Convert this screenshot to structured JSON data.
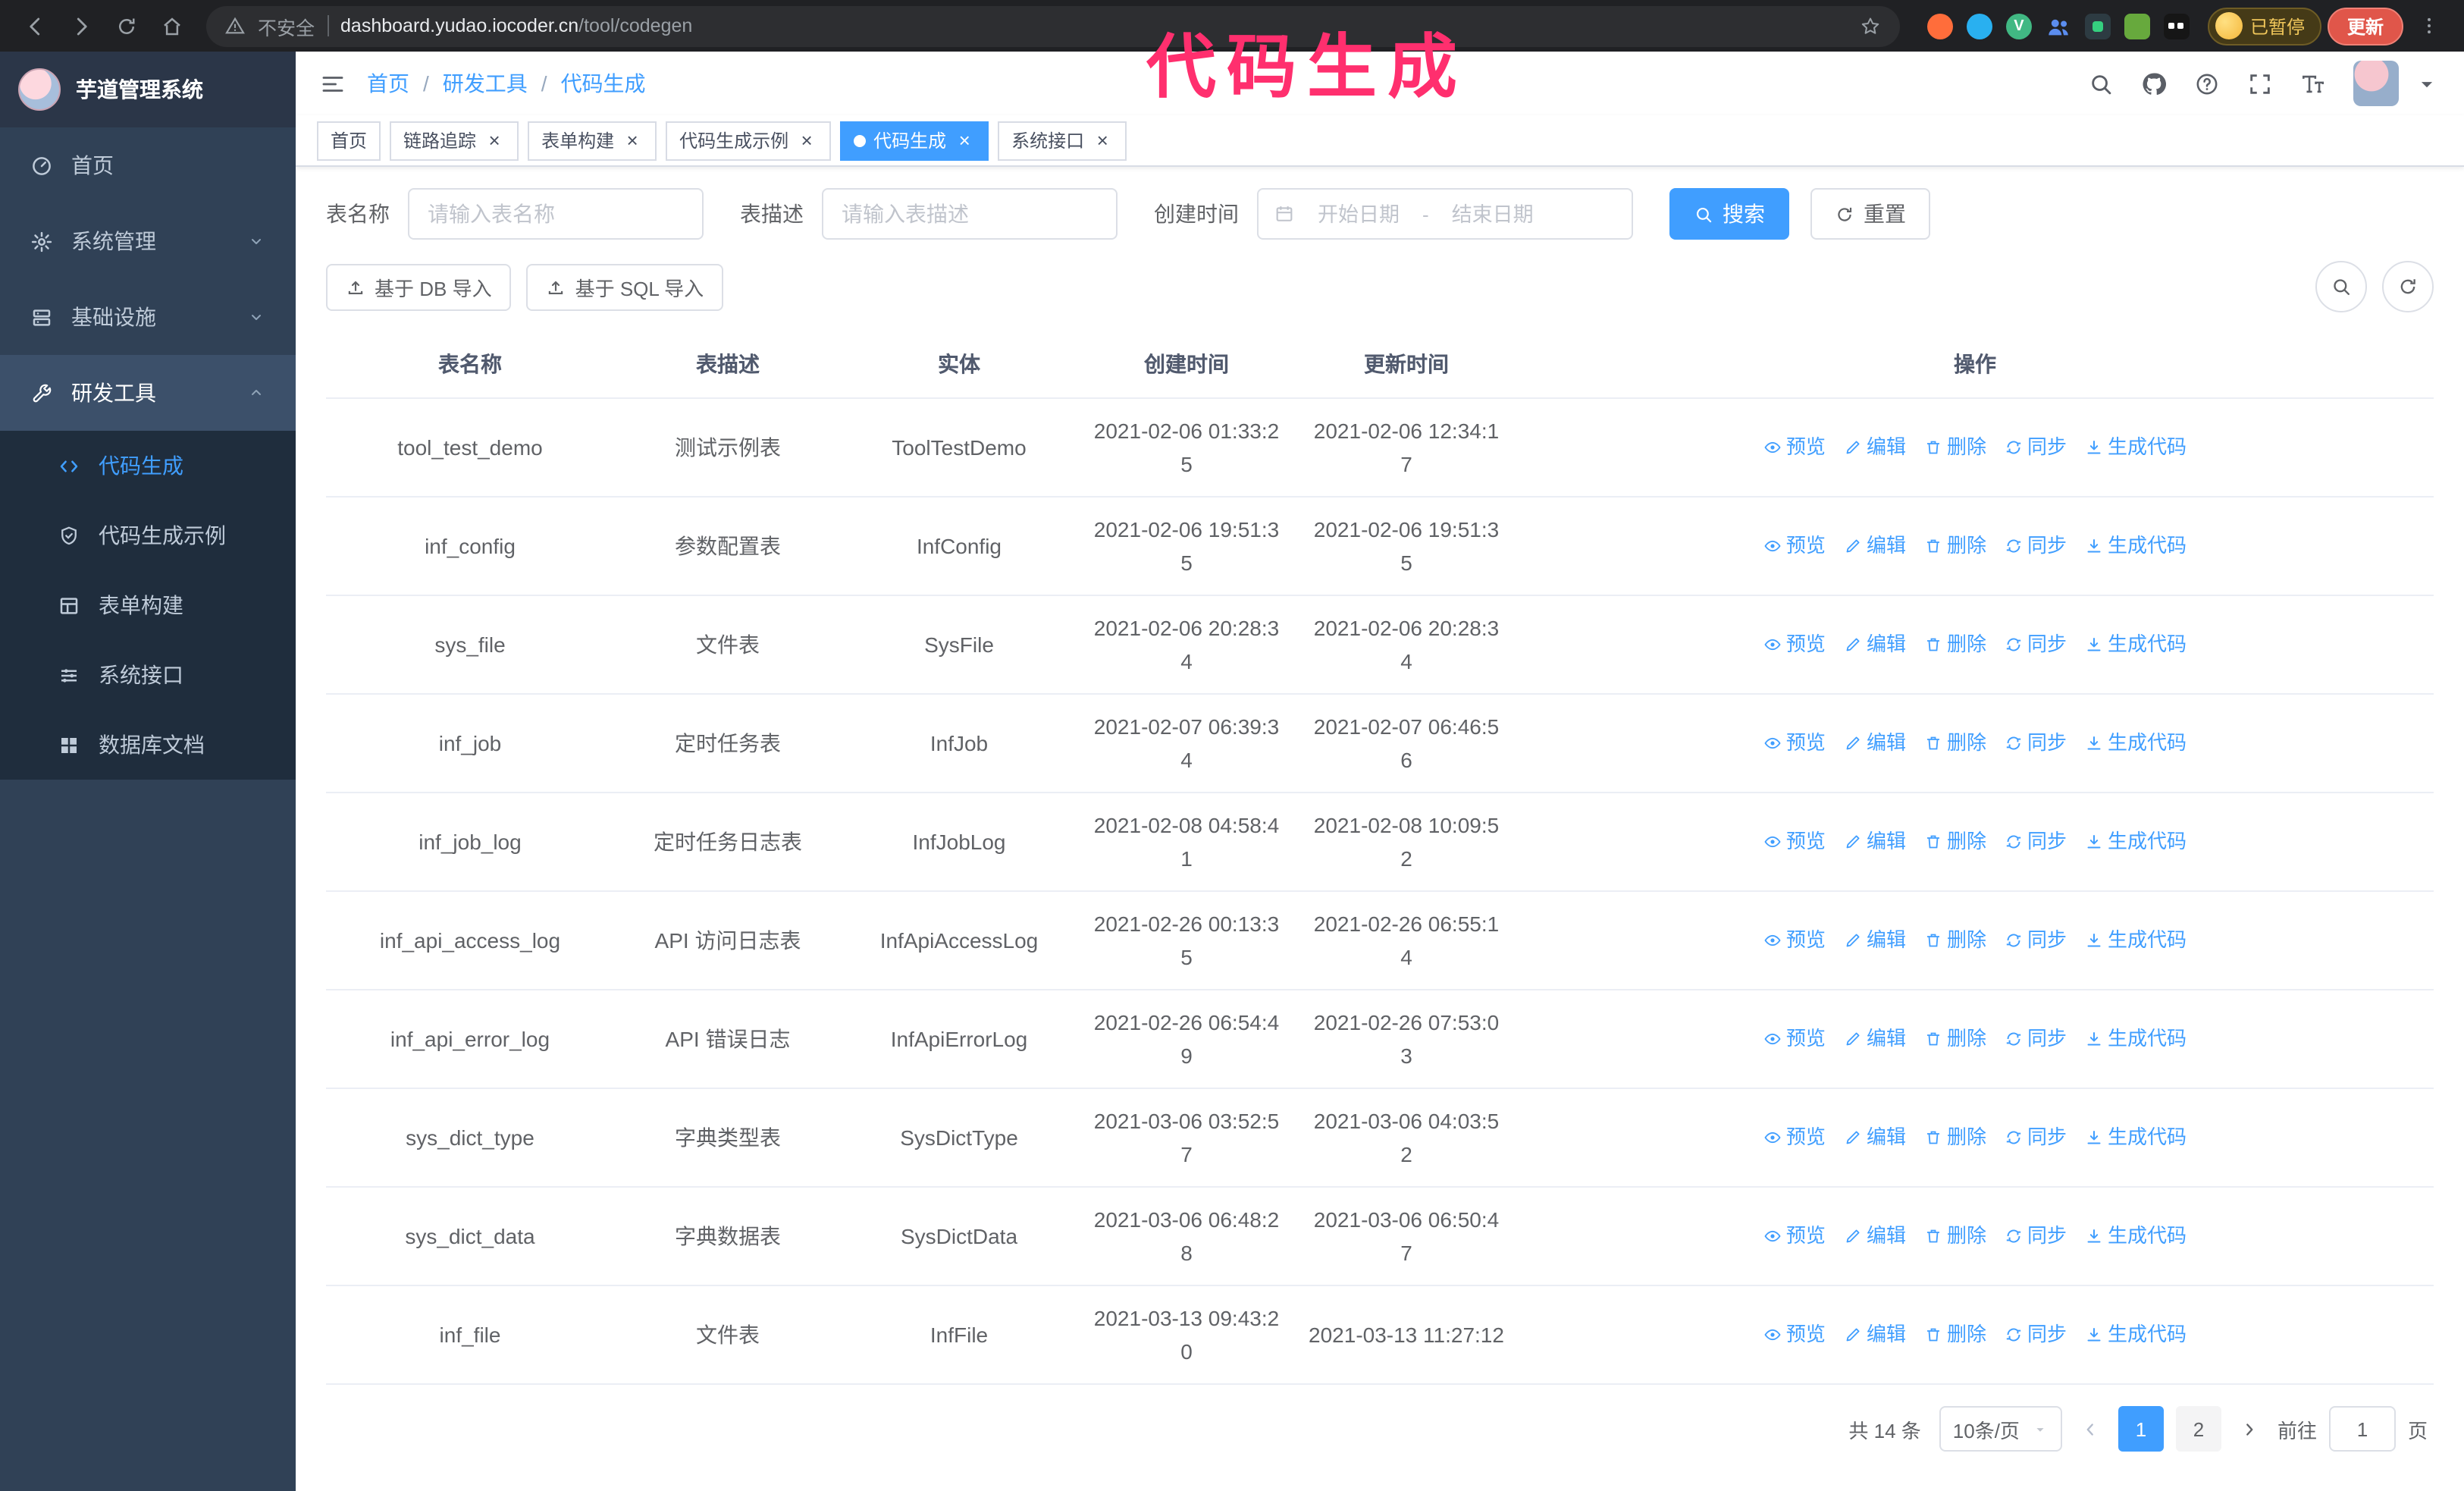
{
  "colors": {
    "accent": "#409eff",
    "sidebar_bg": "#304156",
    "submenu_bg": "#1f2d3d",
    "annotation": "#ff2f6e"
  },
  "annotation": {
    "text": "代码生成"
  },
  "browser": {
    "security_label": "不安全",
    "url_host": "dashboard.yudao.iocoder.cn",
    "url_path": "/tool/codegen",
    "paused_badge": "已暂停",
    "update_button": "更新"
  },
  "sidebar": {
    "logo_title": "芋道管理系统",
    "items": [
      {
        "id": "home",
        "icon": "gauge",
        "label": "首页"
      },
      {
        "id": "system",
        "icon": "gear",
        "label": "系统管理",
        "expandable": true
      },
      {
        "id": "infra",
        "icon": "server",
        "label": "基础设施",
        "expandable": true
      },
      {
        "id": "devtools",
        "icon": "wrench",
        "label": "研发工具",
        "expanded": true
      }
    ],
    "subitems": [
      {
        "id": "codegen",
        "icon": "code",
        "label": "代码生成",
        "active": true
      },
      {
        "id": "codegen-demo",
        "icon": "shield",
        "label": "代码生成示例"
      },
      {
        "id": "form-builder",
        "icon": "form",
        "label": "表单构建"
      },
      {
        "id": "system-api",
        "icon": "sliders",
        "label": "系统接口"
      },
      {
        "id": "db-doc",
        "icon": "grid",
        "label": "数据库文档"
      }
    ]
  },
  "header": {
    "breadcrumb": [
      "首页",
      "研发工具",
      "代码生成"
    ]
  },
  "tags": [
    {
      "id": "home",
      "label": "首页",
      "closable": false
    },
    {
      "id": "tracer",
      "label": "链路追踪",
      "closable": true
    },
    {
      "id": "form-builder",
      "label": "表单构建",
      "closable": true
    },
    {
      "id": "codegen-demo",
      "label": "代码生成示例",
      "closable": true
    },
    {
      "id": "codegen",
      "label": "代码生成",
      "closable": true,
      "active": true
    },
    {
      "id": "system-api",
      "label": "系统接口",
      "closable": true
    }
  ],
  "filters": {
    "table_name_label": "表名称",
    "table_name_placeholder": "请输入表名称",
    "table_desc_label": "表描述",
    "table_desc_placeholder": "请输入表描述",
    "create_time_label": "创建时间",
    "date_start_placeholder": "开始日期",
    "date_separator": "-",
    "date_end_placeholder": "结束日期",
    "search_label": "搜索",
    "reset_label": "重置"
  },
  "toolbar": {
    "import_db_label": "基于 DB 导入",
    "import_sql_label": "基于 SQL 导入"
  },
  "table": {
    "columns": [
      "表名称",
      "表描述",
      "实体",
      "创建时间",
      "更新时间",
      "操作"
    ],
    "actions": [
      "预览",
      "编辑",
      "删除",
      "同步",
      "生成代码"
    ],
    "rows": [
      {
        "name": "tool_test_demo",
        "desc": "测试示例表",
        "entity": "ToolTestDemo",
        "created": "2021-02-06 01:33:25",
        "updated": "2021-02-06 12:34:17"
      },
      {
        "name": "inf_config",
        "desc": "参数配置表",
        "entity": "InfConfig",
        "created": "2021-02-06 19:51:35",
        "updated": "2021-02-06 19:51:35"
      },
      {
        "name": "sys_file",
        "desc": "文件表",
        "entity": "SysFile",
        "created": "2021-02-06 20:28:34",
        "updated": "2021-02-06 20:28:34"
      },
      {
        "name": "inf_job",
        "desc": "定时任务表",
        "entity": "InfJob",
        "created": "2021-02-07 06:39:34",
        "updated": "2021-02-07 06:46:56"
      },
      {
        "name": "inf_job_log",
        "desc": "定时任务日志表",
        "entity": "InfJobLog",
        "created": "2021-02-08 04:58:41",
        "updated": "2021-02-08 10:09:52"
      },
      {
        "name": "inf_api_access_log",
        "desc": "API 访问日志表",
        "entity": "InfApiAccessLog",
        "created": "2021-02-26 00:13:35",
        "updated": "2021-02-26 06:55:14"
      },
      {
        "name": "inf_api_error_log",
        "desc": "API 错误日志",
        "entity": "InfApiErrorLog",
        "created": "2021-02-26 06:54:49",
        "updated": "2021-02-26 07:53:03"
      },
      {
        "name": "sys_dict_type",
        "desc": "字典类型表",
        "entity": "SysDictType",
        "created": "2021-03-06 03:52:57",
        "updated": "2021-03-06 04:03:52"
      },
      {
        "name": "sys_dict_data",
        "desc": "字典数据表",
        "entity": "SysDictData",
        "created": "2021-03-06 06:48:28",
        "updated": "2021-03-06 06:50:47"
      },
      {
        "name": "inf_file",
        "desc": "文件表",
        "entity": "InfFile",
        "created": "2021-03-13 09:43:20",
        "updated": "2021-03-13 11:27:12"
      }
    ]
  },
  "pagination": {
    "total_label": "共 14 条",
    "page_size_label": "10条/页",
    "pages": [
      "1",
      "2"
    ],
    "active_page": "1",
    "goto_prefix": "前往",
    "goto_value": "1",
    "goto_suffix": "页"
  },
  "icons": {
    "chrome": [
      "back",
      "forward",
      "reload",
      "home",
      "warning",
      "star",
      "kebab-menu"
    ],
    "header": [
      "search",
      "github",
      "help",
      "fullscreen",
      "font-size",
      "caret-down"
    ],
    "row_actions": [
      "eye",
      "pencil",
      "trash",
      "sync",
      "download"
    ]
  }
}
